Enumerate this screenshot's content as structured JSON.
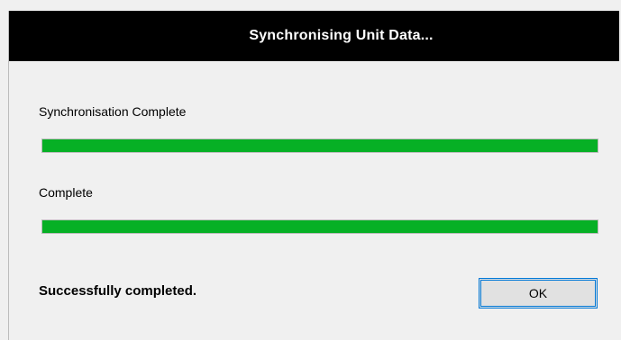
{
  "window": {
    "title": "Synchronising Unit Data..."
  },
  "progress": [
    {
      "label": "Synchronisation Complete",
      "value_percent": 100,
      "fill_color": "#06b025"
    },
    {
      "label": "Complete",
      "value_percent": 100,
      "fill_color": "#06b025"
    }
  ],
  "status_message": "Successfully completed.",
  "buttons": {
    "ok_label": "OK"
  },
  "colors": {
    "titlebar_background": "#000000",
    "titlebar_text": "#ffffff",
    "progress_fill": "#06b025",
    "button_border": "#0078d7"
  }
}
